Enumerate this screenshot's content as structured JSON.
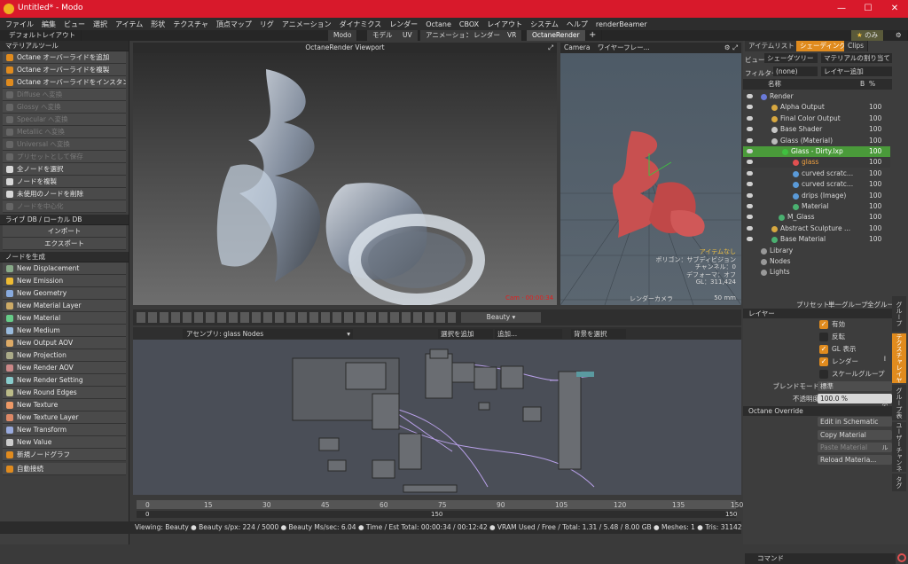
{
  "window": {
    "title": "Untitled* - Modo",
    "min": "—",
    "max": "☐",
    "close": "✕"
  },
  "menu": [
    "ファイル",
    "編集",
    "ビュー",
    "選択",
    "アイテム",
    "形状",
    "テクスチャ",
    "頂点マップ",
    "リグ",
    "アニメーション",
    "ダイナミクス",
    "レンダー",
    "Octane",
    "CBOX",
    "レイアウト",
    "システム",
    "ヘルプ",
    "renderBeamer"
  ],
  "layoutbar": {
    "layout": "デフォルトレイアウト",
    "tabs": [
      "Modo",
      "モデル",
      "UV",
      "アニメーション",
      "レンダー",
      "VR",
      "OctaneRender"
    ],
    "add": "+",
    "onlyme": "のみ"
  },
  "left": {
    "material_tools": "マテリアルツール",
    "tools": [
      {
        "label": "Octane オーバーライドを追加",
        "dis": false
      },
      {
        "label": "Octane オーバーライドを複製",
        "dis": false
      },
      {
        "label": "Octane オーバーライドをインスタンス化",
        "dis": false
      },
      {
        "label": "Diffuse へ変換",
        "dis": true
      },
      {
        "label": "Glossy へ変換",
        "dis": true
      },
      {
        "label": "Specular へ変換",
        "dis": true
      },
      {
        "label": "Metallic へ変換",
        "dis": true
      },
      {
        "label": "Universal へ変換",
        "dis": true
      },
      {
        "label": "プリセットとして保存",
        "dis": true
      },
      {
        "label": "全ノードを選択",
        "dis": false
      },
      {
        "label": "ノードを複製",
        "dis": false
      },
      {
        "label": "未使用のノードを削除",
        "dis": false
      },
      {
        "label": "ノードを中心化",
        "dis": true
      }
    ],
    "livedb": "ライブ DB / ローカル DB",
    "import": "インポート",
    "export": "エクスポート",
    "create_nodes": "ノードを生成",
    "nodes": [
      "New Displacement",
      "New Emission",
      "New Geometry",
      "New Material Layer",
      "New Material",
      "New Medium",
      "New Output AOV",
      "New Projection",
      "New Render AOV",
      "New Render Setting",
      "New Round Edges",
      "New Texture",
      "New Texture Layer",
      "New Transform",
      "New Value",
      "新規ノードグラフ"
    ],
    "autoconnect": "自動接続"
  },
  "viewport": {
    "title": "OctaneRender Viewport"
  },
  "viewport3d": {
    "tabs": [
      "Camera",
      "ワイヤーフレー..."
    ],
    "info": [
      "アイテムなし",
      "ポリゴン：サブディビジョン",
      "チャンネル：0",
      "デフォーマ：オフ",
      "GL：311,424",
      "50 mm"
    ],
    "camera": "レンダーカメラ"
  },
  "toolbar": {
    "pass": "Beauty"
  },
  "schematic": {
    "assembly": "アセンブリ: glass Nodes",
    "add_selected": "選択を追加",
    "add": "追加...",
    "bg_select": "背景を選択"
  },
  "timeline": {
    "ticks": [
      "0",
      "15",
      "30",
      "45",
      "60",
      "75",
      "90",
      "105",
      "120",
      "135",
      "150"
    ],
    "start": "0",
    "mid": "150",
    "end": "150"
  },
  "status": "Viewing: Beauty ● Beauty s/px: 224 / 5000 ● Beauty Ms/sec: 6.04 ● Time / Est Total: 00:00:34 / 00:12:42 ● VRAM Used / Free / Total: 1.31 / 5.48 / 8.00 GB ● Meshes: 1 ● Tris: 311424",
  "right": {
    "tabs": [
      "アイテムリスト",
      "シェーディング",
      "Clips"
    ],
    "view": "ビュー",
    "view_val": "シェーダツリー",
    "assign": "マテリアルの割り当て",
    "filter": "フィルター",
    "filter_val": "(none)",
    "add_layer": "レイヤー追加",
    "col_name": "名称",
    "col_b": "B",
    "col_pct": "%",
    "tree": [
      {
        "name": "Render",
        "indent": 30,
        "pct": "",
        "sel": ""
      },
      {
        "name": "Alpha Output",
        "indent": 42,
        "pct": "100",
        "sel": ""
      },
      {
        "name": "Final Color Output",
        "indent": 42,
        "pct": "100",
        "sel": ""
      },
      {
        "name": "Base Shader",
        "indent": 42,
        "pct": "100",
        "sel": ""
      },
      {
        "name": "Glass (Material)",
        "indent": 42,
        "pct": "100",
        "sel": ""
      },
      {
        "name": "Glass - Dirty.lxp",
        "indent": 54,
        "pct": "100",
        "sel": "sel"
      },
      {
        "name": "glass",
        "indent": 66,
        "pct": "100",
        "sel": "sel2"
      },
      {
        "name": "curved scratc...",
        "indent": 66,
        "pct": "100",
        "sel": ""
      },
      {
        "name": "curved scratc...",
        "indent": 66,
        "pct": "100",
        "sel": ""
      },
      {
        "name": "drips (Image)",
        "indent": 66,
        "pct": "100",
        "sel": ""
      },
      {
        "name": "Material",
        "indent": 66,
        "pct": "100",
        "sel": ""
      },
      {
        "name": "M_Glass",
        "indent": 50,
        "pct": "100",
        "sel": ""
      },
      {
        "name": "Abstract Sculpture ...",
        "indent": 42,
        "pct": "100",
        "sel": ""
      },
      {
        "name": "Base Material",
        "indent": 42,
        "pct": "100",
        "sel": ""
      },
      {
        "name": "Library",
        "indent": 30,
        "pct": "",
        "sel": ""
      },
      {
        "name": "Nodes",
        "indent": 30,
        "pct": "",
        "sel": ""
      },
      {
        "name": "Lights",
        "indent": 30,
        "pct": "",
        "sel": ""
      }
    ],
    "preset": "プリセット",
    "group": "単一グループ",
    "all_group": "全グループ",
    "layer": "レイヤー",
    "props": [
      {
        "k": "",
        "v": "有効",
        "on": true
      },
      {
        "k": "",
        "v": "反転",
        "on": false
      },
      {
        "k": "",
        "v": "GL 表示",
        "on": true
      },
      {
        "k": "",
        "v": "レンダー",
        "on": true
      },
      {
        "k": "",
        "v": "スケールグループ",
        "on": false
      }
    ],
    "blend_k": "ブレンドモード",
    "blend_v": "標準",
    "opacity_k": "不透明度",
    "opacity_v": "100.0 %",
    "octane_override": "Octane Override",
    "ov_buttons": [
      "Edit in Schematic",
      "Copy Material",
      "Paste Material",
      "Reload Materia..."
    ],
    "vtabs": [
      "グループ",
      "テクスチャレイヤー",
      "グループ表示",
      "ユーザーチャンネル",
      "タグ"
    ],
    "command": "コマンド"
  }
}
